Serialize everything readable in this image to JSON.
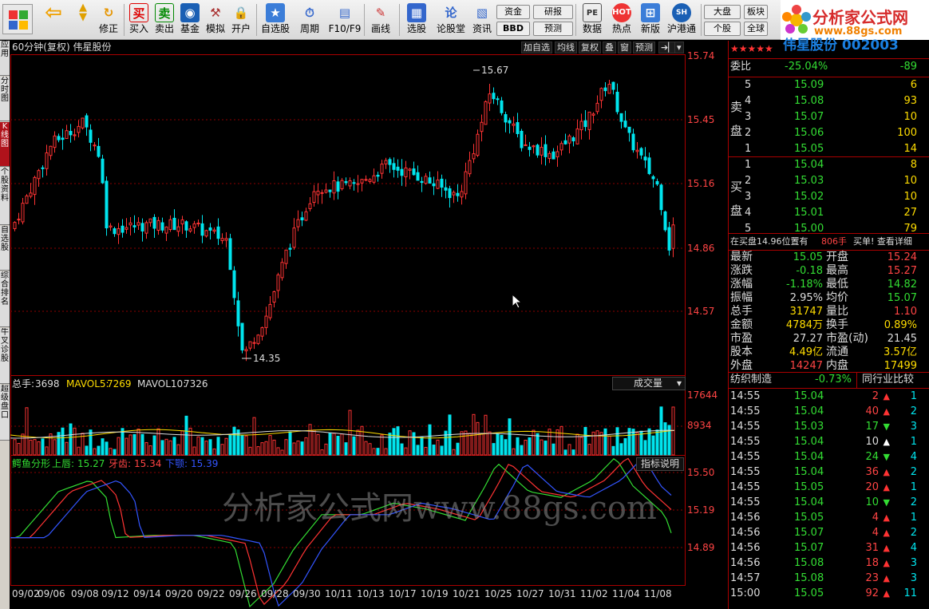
{
  "toolbar": {
    "buttons": [
      "修正",
      "买入",
      "卖出",
      "基金",
      "模拟",
      "开户",
      "自选股",
      "周期",
      "F10/F9",
      "画线",
      "选股",
      "论股堂",
      "资讯",
      "数据",
      "热点",
      "新版",
      "沪港通"
    ],
    "small": [
      "资金",
      "研报",
      "BBD",
      "预测",
      "大盘",
      "板块",
      "个股",
      "全球"
    ]
  },
  "logo": {
    "title": "分析家公式网",
    "url": "www.88gs.com"
  },
  "left_tabs": [
    "应用",
    "分时图",
    "K线图",
    "个股资料",
    "自选股",
    "综合排名",
    "牛叉诊股",
    "超级盘口"
  ],
  "chart_header": {
    "title": "60分钟(复权) 伟星股份",
    "buttons": [
      "加自选",
      "均线",
      "复权",
      "叠",
      "窗",
      "预测"
    ]
  },
  "price_axis": [
    "15.74",
    "15.45",
    "15.16",
    "14.86",
    "14.57"
  ],
  "price_marks": {
    "high": "15.67",
    "low": "14.35"
  },
  "volume_header": {
    "total_label": "总手:",
    "total": "3698",
    "mavol5_label": "MAVOL5:",
    "mavol5": "7269",
    "mavol10_label": "MAVOL10:",
    "mavol10": "7326",
    "name": "成交量"
  },
  "volume_axis": [
    "17644",
    "8934"
  ],
  "indicator_header": {
    "name": "鳄鱼分形",
    "upper_label": "上唇:",
    "upper": "15.27",
    "teeth_label": "牙齿:",
    "teeth": "15.34",
    "lower_label": "下颚:",
    "lower": "15.39",
    "help": "指标说明"
  },
  "indicator_axis": [
    "15.50",
    "15.19",
    "14.89"
  ],
  "date_axis": [
    "09/02",
    "09/06",
    "09/08",
    "09/12",
    "09/14",
    "09/20",
    "09/22",
    "09/26",
    "09/28",
    "09/30",
    "10/11",
    "10/13",
    "10/17",
    "10/19",
    "10/21",
    "10/25",
    "10/27",
    "10/31",
    "11/02",
    "11/04",
    "11/08"
  ],
  "watermark": "分析家公式网www.88gs.com",
  "quote": {
    "name": "伟星股份 002003",
    "webi_label": "委比",
    "webi": "-25.04%",
    "webi_diff": "-89",
    "sell_label": "卖盘",
    "buy_label": "买盘",
    "sell": [
      [
        "5",
        "15.09",
        "6"
      ],
      [
        "4",
        "15.08",
        "93"
      ],
      [
        "3",
        "15.07",
        "10"
      ],
      [
        "2",
        "15.06",
        "100"
      ],
      [
        "1",
        "15.05",
        "14"
      ]
    ],
    "buy": [
      [
        "1",
        "15.04",
        "8"
      ],
      [
        "2",
        "15.03",
        "10"
      ],
      [
        "3",
        "15.02",
        "10"
      ],
      [
        "4",
        "15.01",
        "27"
      ],
      [
        "5",
        "15.00",
        "79"
      ]
    ],
    "notice": "在买盘14.96位置有",
    "notice_vol": "806手",
    "notice_tail": "买单! 查看详细",
    "stats": [
      [
        "最新",
        "15.05",
        "开盘",
        "15.24"
      ],
      [
        "涨跌",
        "-0.18",
        "最高",
        "15.27"
      ],
      [
        "涨幅",
        "-1.18%",
        "最低",
        "14.82"
      ],
      [
        "振幅",
        "2.95%",
        "均价",
        "15.07"
      ],
      [
        "总手",
        "31747",
        "量比",
        "1.10"
      ],
      [
        "金额",
        "4784万",
        "换手",
        "0.89%"
      ],
      [
        "市盈",
        "27.27",
        "市盈(动)",
        "21.45"
      ],
      [
        "股本",
        "4.49亿",
        "流通",
        "3.57亿"
      ],
      [
        "外盘",
        "14247",
        "内盘",
        "17499"
      ]
    ],
    "sector": "纺织制造",
    "sector_pct": "-0.73%",
    "compare": "同行业比较",
    "ticks": [
      [
        "14:55",
        "15.04",
        "2",
        "up",
        "1"
      ],
      [
        "14:55",
        "15.04",
        "40",
        "up",
        "2"
      ],
      [
        "14:55",
        "15.03",
        "17",
        "down",
        "3"
      ],
      [
        "14:55",
        "15.04",
        "10",
        "flat",
        "1"
      ],
      [
        "14:55",
        "15.04",
        "24",
        "down",
        "4"
      ],
      [
        "14:55",
        "15.04",
        "36",
        "up",
        "2"
      ],
      [
        "14:55",
        "15.05",
        "20",
        "up",
        "1"
      ],
      [
        "14:55",
        "15.04",
        "10",
        "down",
        "2"
      ],
      [
        "14:56",
        "15.05",
        "4",
        "up",
        "1"
      ],
      [
        "14:56",
        "15.07",
        "4",
        "up",
        "2"
      ],
      [
        "14:56",
        "15.07",
        "31",
        "up",
        "4"
      ],
      [
        "14:56",
        "15.08",
        "18",
        "up",
        "3"
      ],
      [
        "14:57",
        "15.08",
        "23",
        "up",
        "3"
      ],
      [
        "15:00",
        "15.05",
        "92",
        "up",
        "11"
      ]
    ]
  },
  "colors": {
    "up": "#ff3333",
    "down": "#00e5ee",
    "grid": "#8b0000"
  }
}
